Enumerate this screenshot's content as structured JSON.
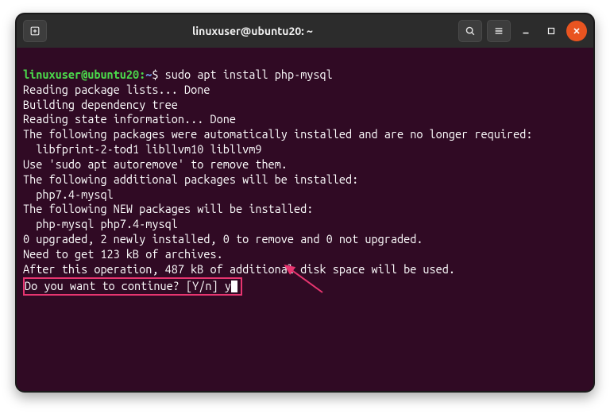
{
  "titlebar": {
    "title": "linuxuser@ubuntu20: ~"
  },
  "prompt": {
    "user_host": "linuxuser@ubuntu20",
    "separator": ":",
    "path": "~",
    "symbol": "$"
  },
  "command": "sudo apt install php-mysql",
  "output_lines": [
    "Reading package lists... Done",
    "Building dependency tree",
    "Reading state information... Done",
    "The following packages were automatically installed and are no longer required:",
    "  libfprint-2-tod1 libllvm10 libllvm9",
    "Use 'sudo apt autoremove' to remove them.",
    "The following additional packages will be installed:",
    "  php7.4-mysql",
    "The following NEW packages will be installed:",
    "  php-mysql php7.4-mysql",
    "0 upgraded, 2 newly installed, 0 to remove and 0 not upgraded.",
    "Need to get 123 kB of archives.",
    "After this operation, 487 kB of additional disk space will be used."
  ],
  "prompt_question": "Do you want to continue? [Y/n] ",
  "user_input": "y",
  "icons": {
    "new_tab": "new-tab-icon",
    "search": "search-icon",
    "menu": "menu-icon",
    "minimize": "minimize-icon",
    "maximize": "maximize-icon",
    "close": "close-icon"
  }
}
